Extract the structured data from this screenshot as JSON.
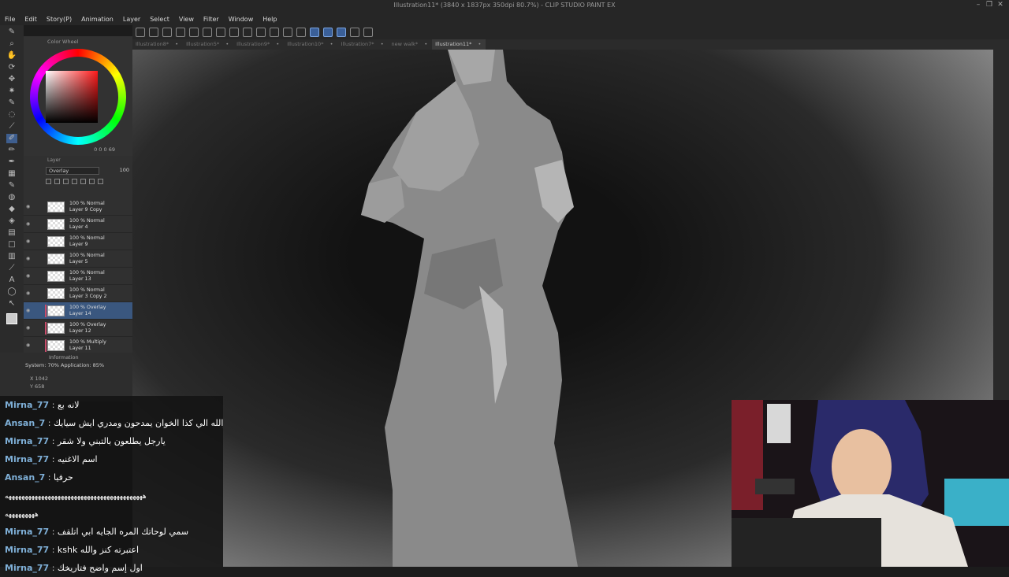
{
  "window": {
    "title": "Illustration11* (3840 x 1837px 350dpi 80.7%) - CLIP STUDIO PAINT EX",
    "controls": [
      "–",
      "❐",
      "✕"
    ]
  },
  "menu": [
    "File",
    "Edit",
    "Story(P)",
    "Animation",
    "Layer",
    "Select",
    "View",
    "Filter",
    "Window",
    "Help"
  ],
  "tabs": [
    {
      "label": "Illustration8*",
      "active": false
    },
    {
      "label": "Illustration5*",
      "active": false
    },
    {
      "label": "Illustration9*",
      "active": false
    },
    {
      "label": "Illustration10*",
      "active": false
    },
    {
      "label": "Illustration7*",
      "active": false
    },
    {
      "label": "new walk*",
      "active": false
    },
    {
      "label": "Illustration11*",
      "active": true
    }
  ],
  "color_panel": {
    "title": "Color Wheel",
    "readout": "0   0   0   69",
    "icons": [
      "color-wheel-icon",
      "settings-icon"
    ]
  },
  "layer_panel": {
    "title": "Layer",
    "blend_mode": "Overlay",
    "opacity": "100",
    "layers": [
      {
        "mode": "100 % Normal",
        "name": "Layer 9 Copy",
        "selected": false,
        "red_mark": false
      },
      {
        "mode": "100 % Normal",
        "name": "Layer 4",
        "selected": false,
        "red_mark": false
      },
      {
        "mode": "100 % Normal",
        "name": "Layer 9",
        "selected": false,
        "red_mark": false
      },
      {
        "mode": "100 % Normal",
        "name": "Layer 5",
        "selected": false,
        "red_mark": false
      },
      {
        "mode": "100 % Normal",
        "name": "Layer 13",
        "selected": false,
        "red_mark": false
      },
      {
        "mode": "100 % Normal",
        "name": "Layer 3 Copy 2",
        "selected": false,
        "red_mark": false
      },
      {
        "mode": "100 % Overlay",
        "name": "Layer 14",
        "selected": true,
        "red_mark": true
      },
      {
        "mode": "100 % Overlay",
        "name": "Layer 12",
        "selected": false,
        "red_mark": true
      },
      {
        "mode": "100 % Multiply",
        "name": "Layer 11",
        "selected": false,
        "red_mark": true
      }
    ]
  },
  "info_panel": {
    "title": "Information",
    "system": "System: 70%  Application: 85%",
    "x": "X  1042",
    "y": "Y  658"
  },
  "chat": [
    {
      "user": "Mirna_77",
      "message": "لانه بع"
    },
    {
      "user": "Ansan_7",
      "message": "والله الي كذا الخوان يمدحون ومدري ايش سيايك"
    },
    {
      "user": "Mirna_77",
      "message": "يارجل يطلعون بالتبني ولا شقر"
    },
    {
      "user": "Mirna_77",
      "message": "اسم الاغنيه"
    },
    {
      "user": "Ansan_7",
      "message": "حرفيا"
    },
    {
      "user": "",
      "message": "ههههههههههههههههههههههههههههههههههههههههههه",
      "long": true
    },
    {
      "user": "",
      "message": "هههههههههه",
      "long": true
    },
    {
      "user": "Mirna_77",
      "message": "سمي لوحاتك المره الجايه ابي اتلقف"
    },
    {
      "user": "Mirna_77",
      "message": "kshk اعتبرته كنز والله"
    },
    {
      "user": "Mirna_77",
      "message": "اول إسم واضح فتاريخك"
    }
  ]
}
